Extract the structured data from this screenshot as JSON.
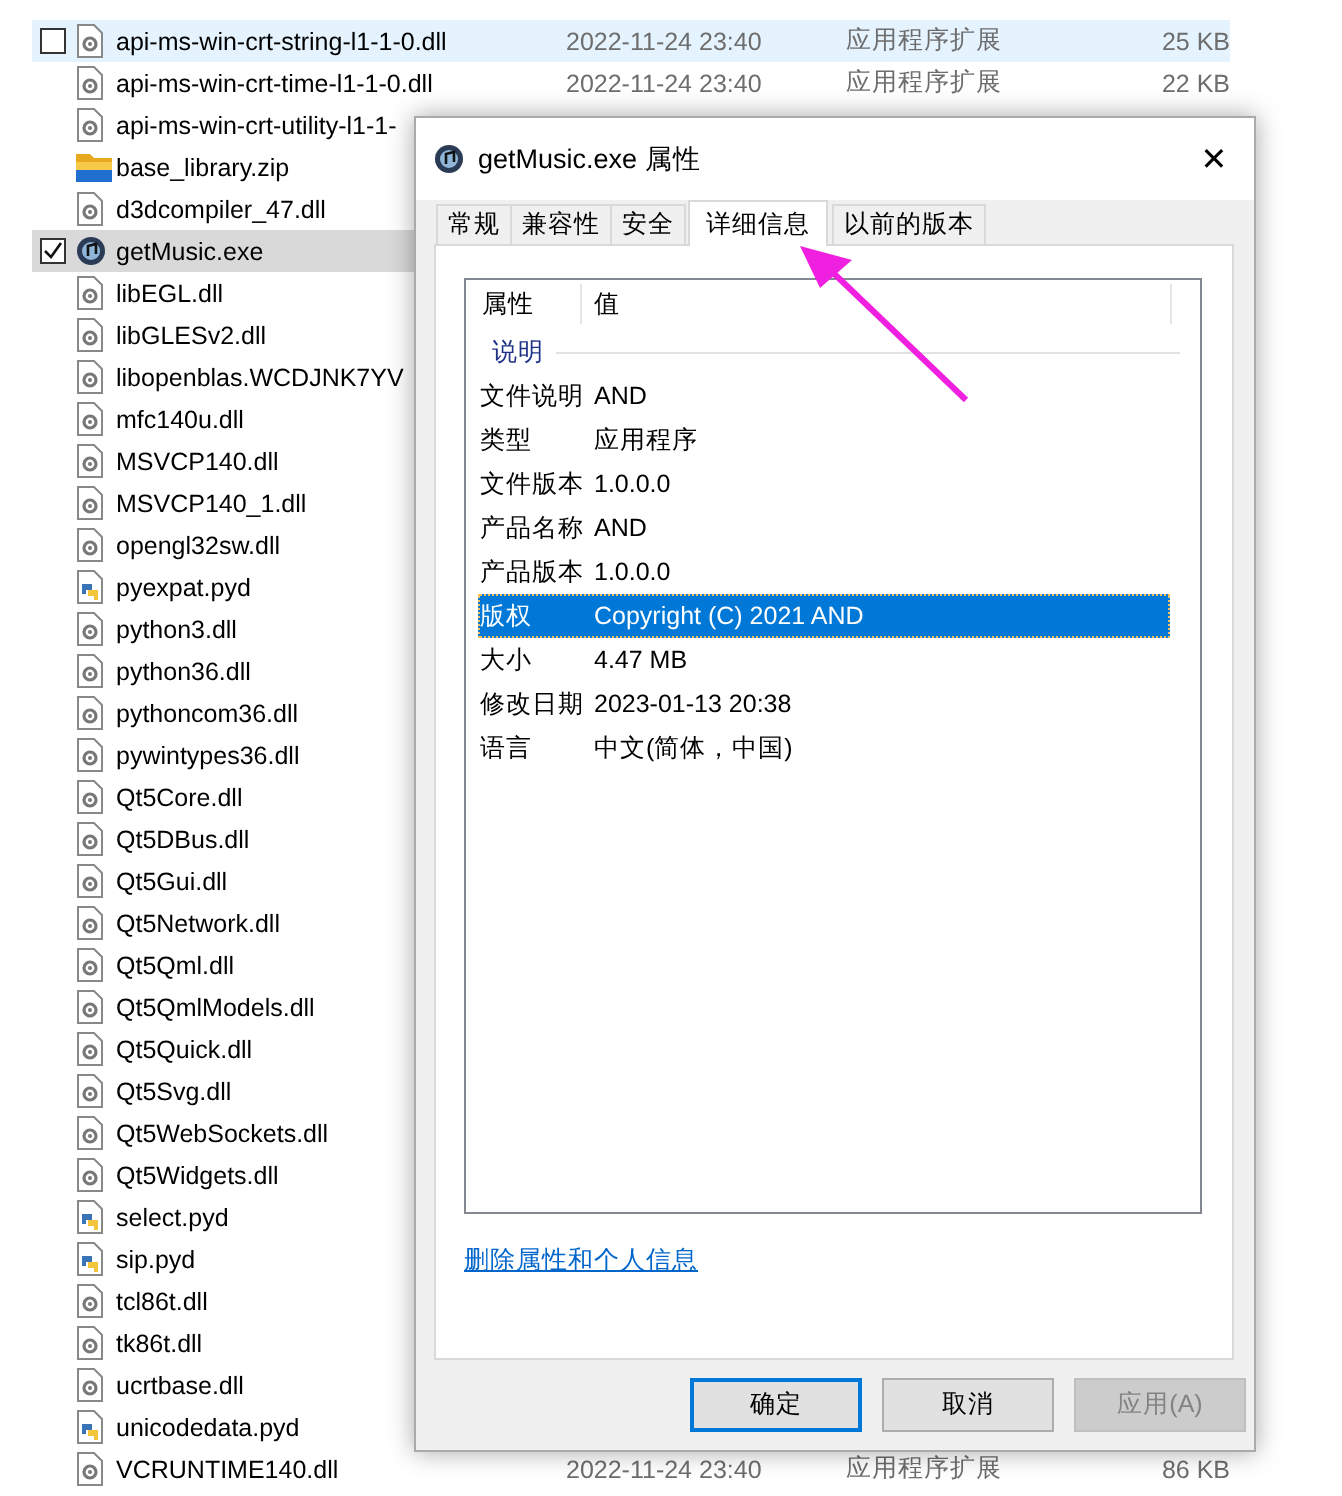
{
  "files": [
    {
      "name": "api-ms-win-crt-string-l1-1-0.dll",
      "kind": "dll",
      "date": "2022-11-24 23:40",
      "type": "应用程序扩展",
      "size": "25 KB",
      "hovered": true,
      "selected": false,
      "checked": false
    },
    {
      "name": "api-ms-win-crt-time-l1-1-0.dll",
      "kind": "dll",
      "date": "2022-11-24 23:40",
      "type": "应用程序扩展",
      "size": "22 KB",
      "hovered": false,
      "selected": false
    },
    {
      "name": "api-ms-win-crt-utility-l1-1-",
      "kind": "dll",
      "hovered": false,
      "selected": false
    },
    {
      "name": "base_library.zip",
      "kind": "zip",
      "hovered": false,
      "selected": false
    },
    {
      "name": "d3dcompiler_47.dll",
      "kind": "dll",
      "hovered": false,
      "selected": false
    },
    {
      "name": "getMusic.exe",
      "kind": "exe",
      "hovered": false,
      "selected": true,
      "checked": true
    },
    {
      "name": "libEGL.dll",
      "kind": "dll",
      "hovered": false,
      "selected": false
    },
    {
      "name": "libGLESv2.dll",
      "kind": "dll",
      "hovered": false,
      "selected": false
    },
    {
      "name": "libopenblas.WCDJNK7YV",
      "kind": "dll",
      "hovered": false,
      "selected": false
    },
    {
      "name": "mfc140u.dll",
      "kind": "dll",
      "hovered": false,
      "selected": false
    },
    {
      "name": "MSVCP140.dll",
      "kind": "dll",
      "hovered": false,
      "selected": false
    },
    {
      "name": "MSVCP140_1.dll",
      "kind": "dll",
      "hovered": false,
      "selected": false
    },
    {
      "name": "opengl32sw.dll",
      "kind": "dll",
      "hovered": false,
      "selected": false
    },
    {
      "name": "pyexpat.pyd",
      "kind": "py",
      "hovered": false,
      "selected": false
    },
    {
      "name": "python3.dll",
      "kind": "dll",
      "hovered": false,
      "selected": false
    },
    {
      "name": "python36.dll",
      "kind": "dll",
      "hovered": false,
      "selected": false
    },
    {
      "name": "pythoncom36.dll",
      "kind": "dll",
      "hovered": false,
      "selected": false
    },
    {
      "name": "pywintypes36.dll",
      "kind": "dll",
      "hovered": false,
      "selected": false
    },
    {
      "name": "Qt5Core.dll",
      "kind": "dll",
      "hovered": false,
      "selected": false
    },
    {
      "name": "Qt5DBus.dll",
      "kind": "dll",
      "hovered": false,
      "selected": false
    },
    {
      "name": "Qt5Gui.dll",
      "kind": "dll",
      "hovered": false,
      "selected": false
    },
    {
      "name": "Qt5Network.dll",
      "kind": "dll",
      "hovered": false,
      "selected": false
    },
    {
      "name": "Qt5Qml.dll",
      "kind": "dll",
      "hovered": false,
      "selected": false
    },
    {
      "name": "Qt5QmlModels.dll",
      "kind": "dll",
      "hovered": false,
      "selected": false
    },
    {
      "name": "Qt5Quick.dll",
      "kind": "dll",
      "hovered": false,
      "selected": false
    },
    {
      "name": "Qt5Svg.dll",
      "kind": "dll",
      "hovered": false,
      "selected": false
    },
    {
      "name": "Qt5WebSockets.dll",
      "kind": "dll",
      "hovered": false,
      "selected": false
    },
    {
      "name": "Qt5Widgets.dll",
      "kind": "dll",
      "hovered": false,
      "selected": false
    },
    {
      "name": "select.pyd",
      "kind": "py",
      "hovered": false,
      "selected": false
    },
    {
      "name": "sip.pyd",
      "kind": "py",
      "hovered": false,
      "selected": false
    },
    {
      "name": "tcl86t.dll",
      "kind": "dll",
      "hovered": false,
      "selected": false
    },
    {
      "name": "tk86t.dll",
      "kind": "dll",
      "hovered": false,
      "selected": false
    },
    {
      "name": "ucrtbase.dll",
      "kind": "dll",
      "hovered": false,
      "selected": false
    },
    {
      "name": "unicodedata.pyd",
      "kind": "py",
      "hovered": false,
      "selected": false
    },
    {
      "name": "VCRUNTIME140.dll",
      "kind": "dll",
      "date": "2022-11-24 23:40",
      "type": "应用程序扩展",
      "size": "86 KB",
      "hovered": false,
      "selected": false
    }
  ],
  "dialog": {
    "title": "getMusic.exe 属性",
    "close": "✕",
    "tabs": [
      {
        "label": "常规",
        "selected": false
      },
      {
        "label": "兼容性",
        "selected": false
      },
      {
        "label": "安全",
        "selected": false
      },
      {
        "label": "详细信息",
        "selected": true
      },
      {
        "label": "以前的版本",
        "selected": false
      }
    ],
    "columns": [
      "属性",
      "值"
    ],
    "group": "说明",
    "rows": [
      {
        "name": "文件说明",
        "value": "AND",
        "selected": false
      },
      {
        "name": "类型",
        "value": "应用程序",
        "selected": false
      },
      {
        "name": "文件版本",
        "value": "1.0.0.0",
        "selected": false
      },
      {
        "name": "产品名称",
        "value": "AND",
        "selected": false
      },
      {
        "name": "产品版本",
        "value": "1.0.0.0",
        "selected": false
      },
      {
        "name": "版权",
        "value": "Copyright (C) 2021 AND",
        "selected": true
      },
      {
        "name": "大小",
        "value": "4.47 MB",
        "selected": false
      },
      {
        "name": "修改日期",
        "value": "2023-01-13 20:38",
        "selected": false
      },
      {
        "name": "语言",
        "value": "中文(简体，中国)",
        "selected": false
      }
    ],
    "link": "删除属性和个人信息",
    "buttons": [
      {
        "label": "确定",
        "kind": "default"
      },
      {
        "label": "取消",
        "kind": "normal"
      },
      {
        "label": "应用(A)",
        "kind": "disabled"
      }
    ]
  }
}
